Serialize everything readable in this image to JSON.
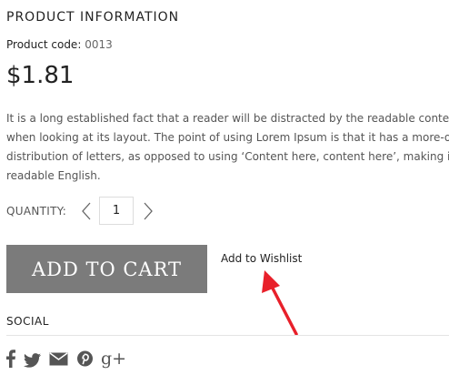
{
  "product": {
    "heading": "PRODUCT INFORMATION",
    "code_label": "Product code:",
    "code_value": "0013",
    "price": "$1.81",
    "description": [
      "It is a long established fact that a reader will be distracted by the readable content",
      "when looking at its layout. The point of using Lorem Ipsum is that it has a more-or-",
      "distribution of letters, as opposed to using ‘Content here, content here’, making it l",
      "readable English."
    ]
  },
  "quantity": {
    "label": "QUANTITY:",
    "value": "1",
    "decrease_icon": "chevron-left-icon",
    "increase_icon": "chevron-right-icon"
  },
  "actions": {
    "add_to_cart": "ADD TO CART",
    "add_to_wishlist": "Add to Wishlist",
    "annotation_arrow_color": "#e8202a"
  },
  "social": {
    "heading": "SOCIAL",
    "icons": [
      "facebook-icon",
      "twitter-icon",
      "email-icon",
      "pinterest-icon",
      "google-plus-icon"
    ],
    "gplus_glyph": "g+"
  },
  "colors": {
    "button_bg": "#7b7b7b",
    "text": "#222222",
    "muted": "#555555"
  }
}
